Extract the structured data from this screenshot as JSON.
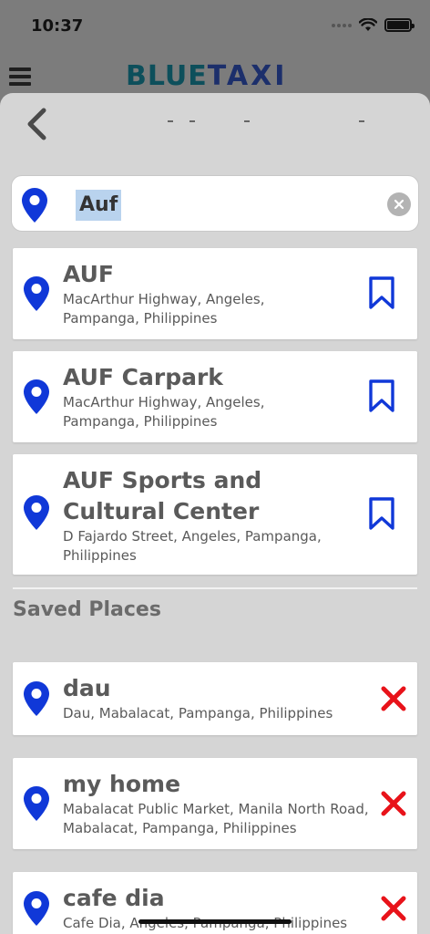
{
  "status": {
    "time": "10:37"
  },
  "brand": {
    "part1": "BLUE",
    "part2": "TAXI"
  },
  "search": {
    "value": "Auf"
  },
  "results": [
    {
      "title": "AUF",
      "address": "MacArthur Highway, Angeles, Pampanga, Philippines"
    },
    {
      "title": "AUF Carpark",
      "address": "MacArthur Highway, Angeles, Pampanga, Philippines"
    },
    {
      "title": "AUF Sports and Cultural Center",
      "address": "D Fajardo Street, Angeles, Pampanga, Philippines"
    }
  ],
  "saved": {
    "heading": "Saved Places",
    "items": [
      {
        "title": "dau",
        "address": "Dau, Mabalacat, Pampanga, Philippines"
      },
      {
        "title": "my home",
        "address": "Mabalacat Public Market, Manila North Road, Mabalacat, Pampanga, Philippines"
      },
      {
        "title": "cafe dia",
        "address": "Cafe Dia, Angeles, Pampanga, Philippines"
      }
    ]
  },
  "colors": {
    "pin": "#1038d8",
    "bookmark": "#1038d8",
    "remove": "#e8131a",
    "sheet": "#d5d5d5"
  },
  "icons": {
    "pin": "location-pin-icon",
    "bookmark": "bookmark-icon",
    "remove": "close-x-icon",
    "back": "chevron-left-icon",
    "clear": "clear-circle-icon",
    "menu": "hamburger-menu-icon"
  }
}
